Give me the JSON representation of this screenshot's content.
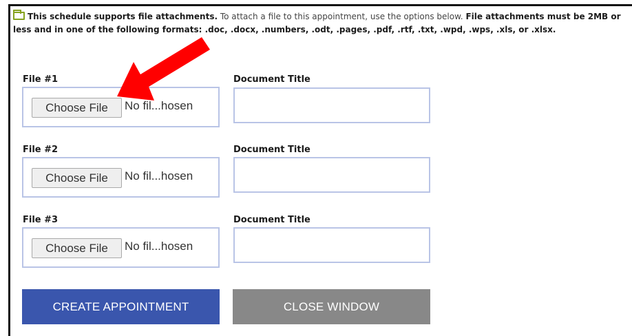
{
  "notice": {
    "bold_intro": "This schedule supports file attachments.",
    "text1": " To attach a file to this appointment, use the options below. ",
    "bold_rule": "File attachments must be 2MB or less and in one of the following formats: .doc, .docx, .numbers, .odt, .pages, .pdf, .rtf, .txt, .wpd, .wps, .xls, or .xlsx."
  },
  "files": [
    {
      "label": "File #1",
      "button": "Choose File",
      "status": "No fil...hosen",
      "title_label": "Document Title",
      "title_value": ""
    },
    {
      "label": "File #2",
      "button": "Choose File",
      "status": "No fil...hosen",
      "title_label": "Document Title",
      "title_value": ""
    },
    {
      "label": "File #3",
      "button": "Choose File",
      "status": "No fil...hosen",
      "title_label": "Document Title",
      "title_value": ""
    }
  ],
  "actions": {
    "create": "CREATE APPOINTMENT",
    "close": "CLOSE WINDOW"
  },
  "colors": {
    "create_bg": "#3a56ad",
    "close_bg": "#888888",
    "arrow": "#ff0000",
    "folder_icon": "#86a21e"
  },
  "icons": {
    "notice": "folder-icon",
    "annotation": "red-arrow-icon"
  }
}
